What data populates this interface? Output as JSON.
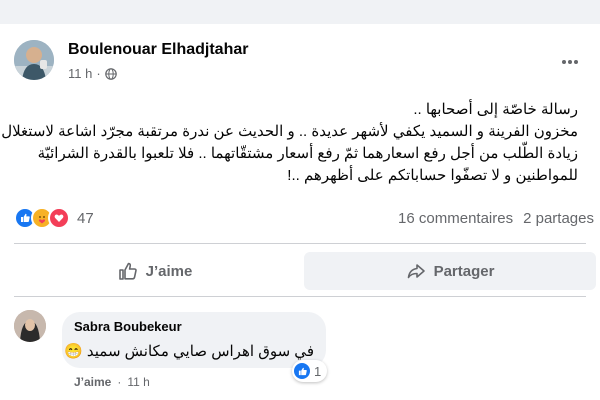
{
  "post": {
    "author": "Boulenouar Elhadjtahar",
    "time": "11 h",
    "dot": "·",
    "lines": [
      "رسالة خاصّة إلى أصحابها ..",
      "مخزون الفرينة و السميد يكفي لأشهر عديدة .. و الحديث عن ندرة مرتقبة مجرّد اشاعة لاستغلال",
      "زيادة الطّلب من أجل رفع اسعارهما ثمّ رفع أسعار مشتقّاتهما .. فلا تلعبوا بالقدرة الشرائيّة",
      "للمواطنين و لا تصفّوا حساباتكم على أظهرهم ..!"
    ],
    "reactions": {
      "icons": [
        "like-icon",
        "care-icon",
        "love-icon"
      ],
      "count": "47",
      "colors": {
        "like": "#1877f2",
        "care": "#f7b125",
        "love": "#f33e58"
      }
    },
    "comments_count": "16 commentaires",
    "shares_count": "2 partages"
  },
  "actions": {
    "like_label": "J’aime",
    "share_label": "Partager"
  },
  "comment": {
    "author": "Sabra Boubekeur",
    "text": "في سوق اهراس صايي مكانش سميد 😁",
    "reaction_count": "1",
    "like_label": "J’aime",
    "dot": "·",
    "time": "11 h"
  }
}
